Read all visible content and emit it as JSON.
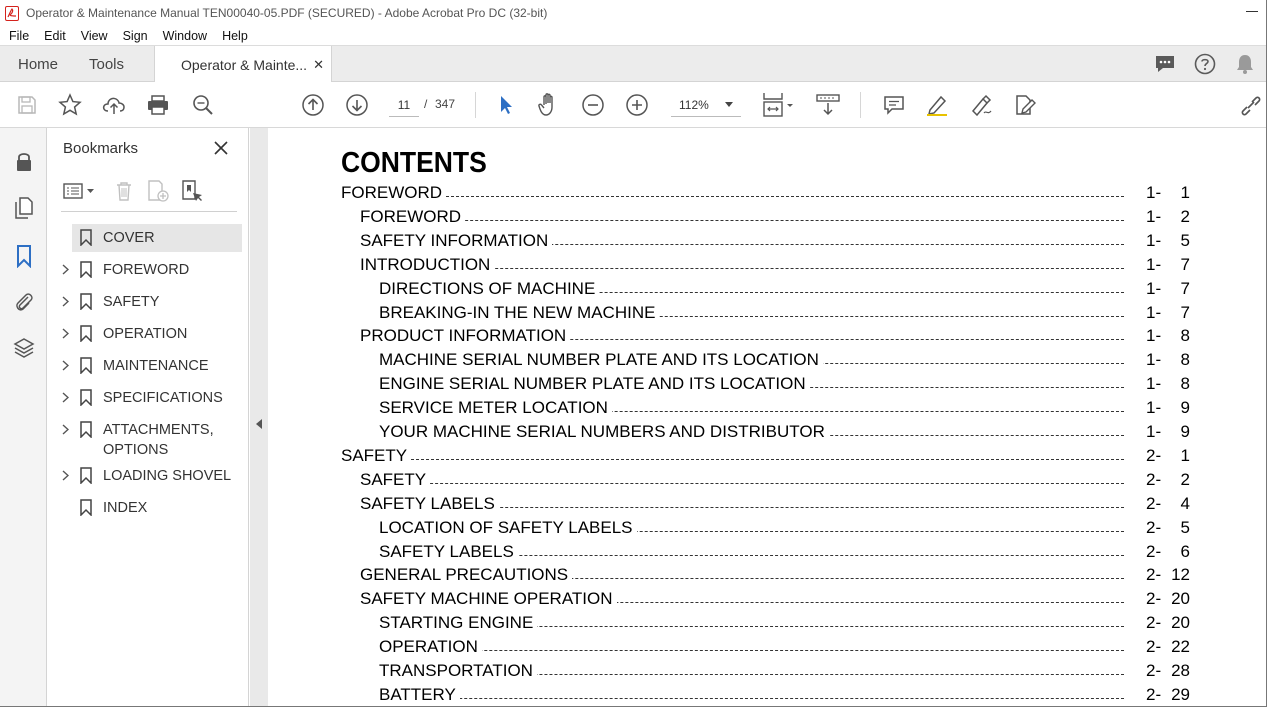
{
  "window": {
    "title": "Operator & Maintenance Manual TEN00040-05.PDF (SECURED) - Adobe Acrobat Pro DC (32-bit)"
  },
  "menu": [
    "File",
    "Edit",
    "View",
    "Sign",
    "Window",
    "Help"
  ],
  "tabs": {
    "home": "Home",
    "tools": "Tools",
    "document": "Operator & Mainte..."
  },
  "toolbar": {
    "current_page": "11",
    "page_separator": "/",
    "total_pages": "347",
    "zoom": "112%"
  },
  "bookmarks": {
    "title": "Bookmarks",
    "items": [
      {
        "label": "COVER",
        "expandable": false,
        "selected": true
      },
      {
        "label": "FOREWORD",
        "expandable": true,
        "selected": false
      },
      {
        "label": "SAFETY",
        "expandable": true,
        "selected": false
      },
      {
        "label": "OPERATION",
        "expandable": true,
        "selected": false
      },
      {
        "label": "MAINTENANCE",
        "expandable": true,
        "selected": false
      },
      {
        "label": "SPECIFICATIONS",
        "expandable": true,
        "selected": false
      },
      {
        "label": "ATTACHMENTS, OPTIONS",
        "expandable": true,
        "selected": false
      },
      {
        "label": "LOADING SHOVEL",
        "expandable": true,
        "selected": false
      },
      {
        "label": "INDEX",
        "expandable": false,
        "selected": false
      }
    ]
  },
  "document": {
    "heading": "CONTENTS",
    "toc": [
      {
        "text": "FOREWORD",
        "level": 0,
        "chapter": "1-",
        "page": "1"
      },
      {
        "text": "FOREWORD",
        "level": 1,
        "chapter": "1-",
        "page": "2"
      },
      {
        "text": "SAFETY INFORMATION",
        "level": 1,
        "chapter": "1-",
        "page": "5"
      },
      {
        "text": "INTRODUCTION",
        "level": 1,
        "chapter": "1-",
        "page": "7"
      },
      {
        "text": "DIRECTIONS OF MACHINE",
        "level": 2,
        "chapter": "1-",
        "page": "7"
      },
      {
        "text": "BREAKING-IN THE NEW MACHINE",
        "level": 2,
        "chapter": "1-",
        "page": "7"
      },
      {
        "text": "PRODUCT INFORMATION",
        "level": 1,
        "chapter": "1-",
        "page": "8"
      },
      {
        "text": "MACHINE SERIAL NUMBER PLATE AND ITS LOCATION",
        "level": 2,
        "chapter": "1-",
        "page": "8"
      },
      {
        "text": "ENGINE SERIAL NUMBER PLATE AND ITS LOCATION",
        "level": 2,
        "chapter": "1-",
        "page": "8"
      },
      {
        "text": "SERVICE METER LOCATION",
        "level": 2,
        "chapter": "1-",
        "page": "9"
      },
      {
        "text": "YOUR MACHINE SERIAL NUMBERS AND DISTRIBUTOR",
        "level": 2,
        "chapter": "1-",
        "page": "9"
      },
      {
        "text": "SAFETY",
        "level": 0,
        "chapter": "2-",
        "page": "1"
      },
      {
        "text": "SAFETY",
        "level": 1,
        "chapter": "2-",
        "page": "2"
      },
      {
        "text": "SAFETY LABELS",
        "level": 1,
        "chapter": "2-",
        "page": "4"
      },
      {
        "text": "LOCATION OF SAFETY LABELS",
        "level": 2,
        "chapter": "2-",
        "page": "5"
      },
      {
        "text": "SAFETY LABELS",
        "level": 2,
        "chapter": "2-",
        "page": "6"
      },
      {
        "text": "GENERAL PRECAUTIONS",
        "level": 1,
        "chapter": "2-",
        "page": "12"
      },
      {
        "text": "SAFETY MACHINE OPERATION",
        "level": 1,
        "chapter": "2-",
        "page": "20"
      },
      {
        "text": "STARTING ENGINE",
        "level": 2,
        "chapter": "2-",
        "page": "20"
      },
      {
        "text": "OPERATION",
        "level": 2,
        "chapter": "2-",
        "page": "22"
      },
      {
        "text": "TRANSPORTATION",
        "level": 2,
        "chapter": "2-",
        "page": "28"
      },
      {
        "text": "BATTERY",
        "level": 2,
        "chapter": "2-",
        "page": "29"
      }
    ]
  },
  "colors": {
    "accent_blue": "#2d6fc4",
    "tabbar_bg": "#ececec",
    "acrobat_red": "#d4221c"
  }
}
